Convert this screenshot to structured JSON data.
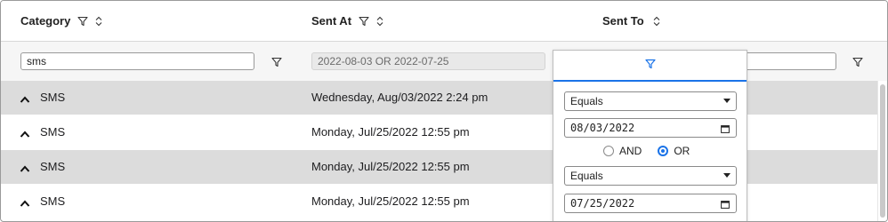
{
  "columns": {
    "category": {
      "label": "Category",
      "filter_value": "sms"
    },
    "sent_at": {
      "label": "Sent At",
      "filter_value": "2022-08-03 OR 2022-07-25"
    },
    "sent_to": {
      "label": "Sent To"
    }
  },
  "rows": [
    {
      "category": "SMS",
      "sent_at": "Wednesday, Aug/03/2022 2:24 pm",
      "shaded": true
    },
    {
      "category": "SMS",
      "sent_at": "Monday, Jul/25/2022 12:55 pm",
      "shaded": false
    },
    {
      "category": "SMS",
      "sent_at": "Monday, Jul/25/2022 12:55 pm",
      "shaded": true
    },
    {
      "category": "SMS",
      "sent_at": "Monday, Jul/25/2022 12:55 pm",
      "shaded": false
    }
  ],
  "popup": {
    "condition1": "Equals",
    "date1": "08/03/2022",
    "join_and": "AND",
    "join_or": "OR",
    "join_selected": "OR",
    "condition2": "Equals",
    "date2": "07/25/2022"
  },
  "colors": {
    "accent": "#1a73e8",
    "row_shade": "#dcdcdc"
  },
  "icons": [
    "filter-icon",
    "sort-icon",
    "chevron-up-icon",
    "calendar-icon"
  ]
}
